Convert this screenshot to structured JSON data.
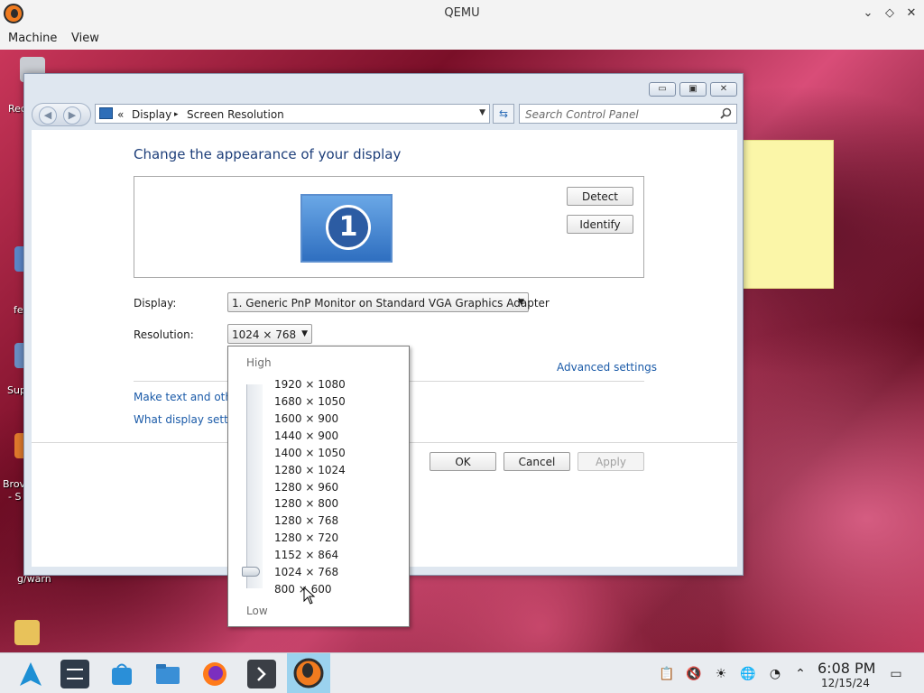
{
  "qemu": {
    "title": "QEMU",
    "menu": [
      "Machine",
      "View"
    ],
    "controls": [
      "minimize-chevron",
      "restore-diamond",
      "close-x"
    ]
  },
  "desktop": {
    "icon_labels": [
      "Rec",
      "fe",
      "Sup",
      "Brov",
      "- S",
      "g/warn"
    ]
  },
  "window": {
    "breadcrumb": {
      "back_glyph": "«",
      "part1": "Display",
      "sep": "▸",
      "part2": "Screen Resolution"
    },
    "search": {
      "placeholder": "Search Control Panel"
    },
    "heading": "Change the appearance of your display",
    "monitor_number": "1",
    "buttons": {
      "detect": "Detect",
      "identify": "Identify"
    },
    "display_label": "Display:",
    "display_value": "1. Generic PnP Monitor on Standard VGA Graphics Adapter",
    "resolution_label": "Resolution:",
    "resolution_value": "1024 × 768",
    "advanced_link": "Advanced settings",
    "link_text_size": "Make text and other",
    "link_what_settings": "What display setting",
    "ok": "OK",
    "cancel": "Cancel",
    "apply": "Apply"
  },
  "resolution_popup": {
    "high_label": "High",
    "low_label": "Low",
    "options": [
      "1920 × 1080",
      "1680 × 1050",
      "1600 × 900",
      "1440 × 900",
      "1400 × 1050",
      "1280 × 1024",
      "1280 × 960",
      "1280 × 800",
      "1280 × 768",
      "1280 × 720",
      "1152 × 864",
      "1024 × 768",
      "800 × 600"
    ],
    "selected": "1024 × 768"
  },
  "taskbar": {
    "items": [
      "arch-launcher-icon",
      "settings-mixer-icon",
      "software-store-icon",
      "file-manager-icon",
      "firefox-icon",
      "terminal-icon",
      "qemu-icon"
    ],
    "active": "qemu-icon",
    "tray": [
      "clipboard-icon",
      "speaker-muted-icon",
      "brightness-icon",
      "network-icon",
      "updates-icon",
      "chevron-up-icon"
    ],
    "time": "6:08 PM",
    "date": "12/15/24"
  },
  "colors": {
    "heading": "#1e3f7a",
    "link": "#1a5aa8",
    "taskbar_active": "#9bd2ee"
  }
}
